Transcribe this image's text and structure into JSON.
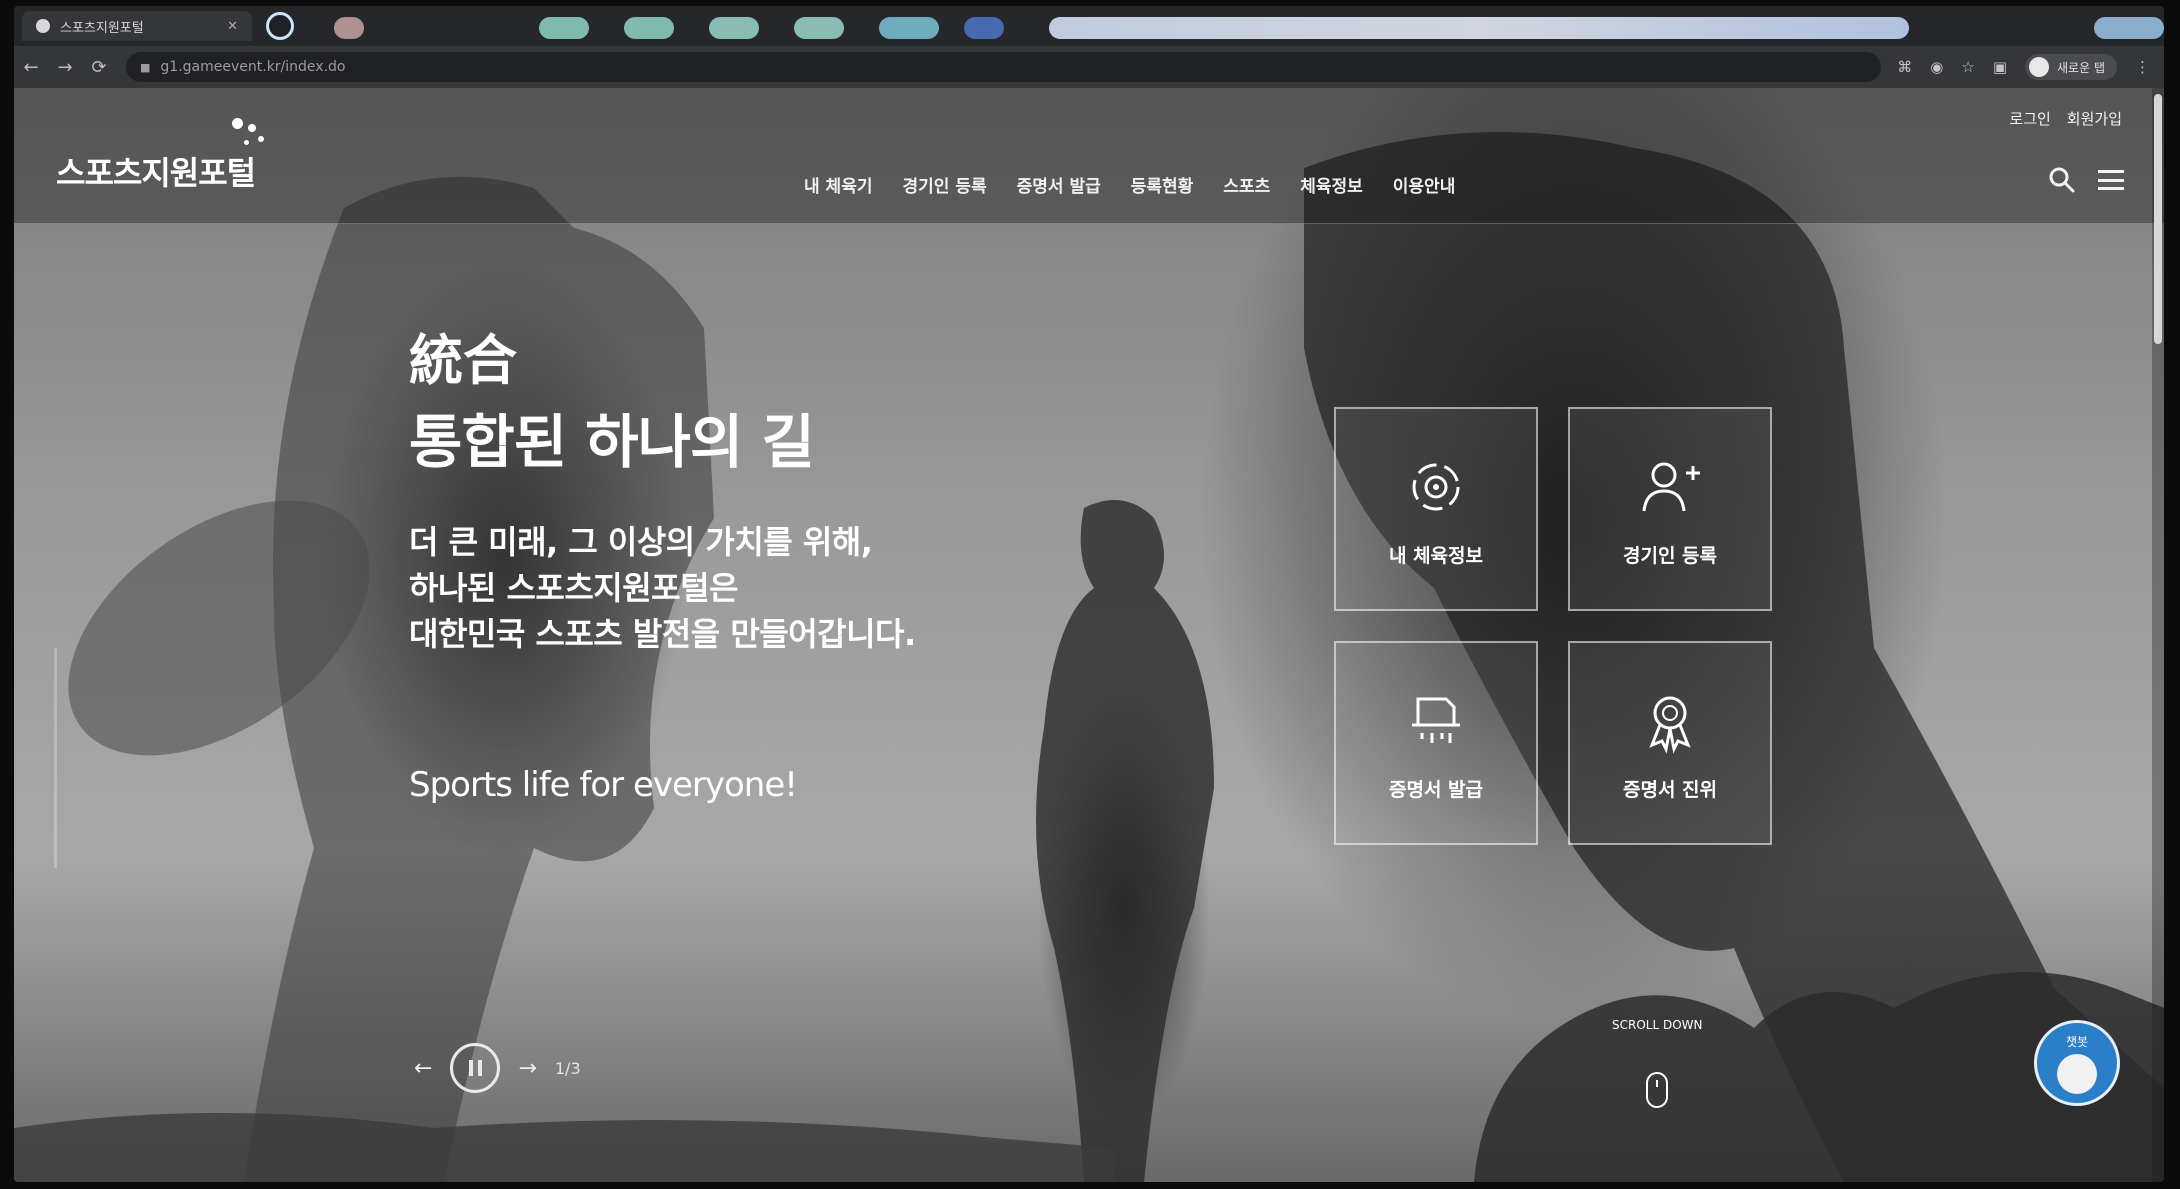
{
  "browser": {
    "tab_title": "스포츠지원포털",
    "url": "g1.gameevent.kr/index.do",
    "profile_label": "새로운 탭"
  },
  "header": {
    "logo_text": "스포츠지원포털",
    "nav": [
      "내 체육기",
      "경기인 등록",
      "증명서 발급",
      "등록현황",
      "스포츠",
      "체육정보",
      "이용안내"
    ],
    "util": {
      "login": "로그인",
      "signup": "회원가입"
    }
  },
  "hero": {
    "hanja": "統合",
    "headline": "통합된 하나의 길",
    "desc": [
      "더 큰 미래, 그 이상의 가치를 위해,",
      "하나된 스포츠지원포털은",
      "대한민국 스포츠 발전을 만들어갑니다."
    ],
    "slogan": "Sports life for everyone!"
  },
  "quick_menu": [
    {
      "label": "내 체육정보",
      "icon": "target-icon"
    },
    {
      "label": "경기인 등록",
      "icon": "user-plus-icon"
    },
    {
      "label": "증명서 발급",
      "icon": "printer-icon"
    },
    {
      "label": "증명서 진위",
      "icon": "award-icon"
    }
  ],
  "slider": {
    "pager": "1/3",
    "prev": "←",
    "next": "→"
  },
  "scroll_hint": "SCROLL DOWN",
  "chatbot": {
    "label": "챗봇"
  },
  "colors": {
    "overlay": "#141414",
    "accent_chat": "#2b7fc8"
  }
}
